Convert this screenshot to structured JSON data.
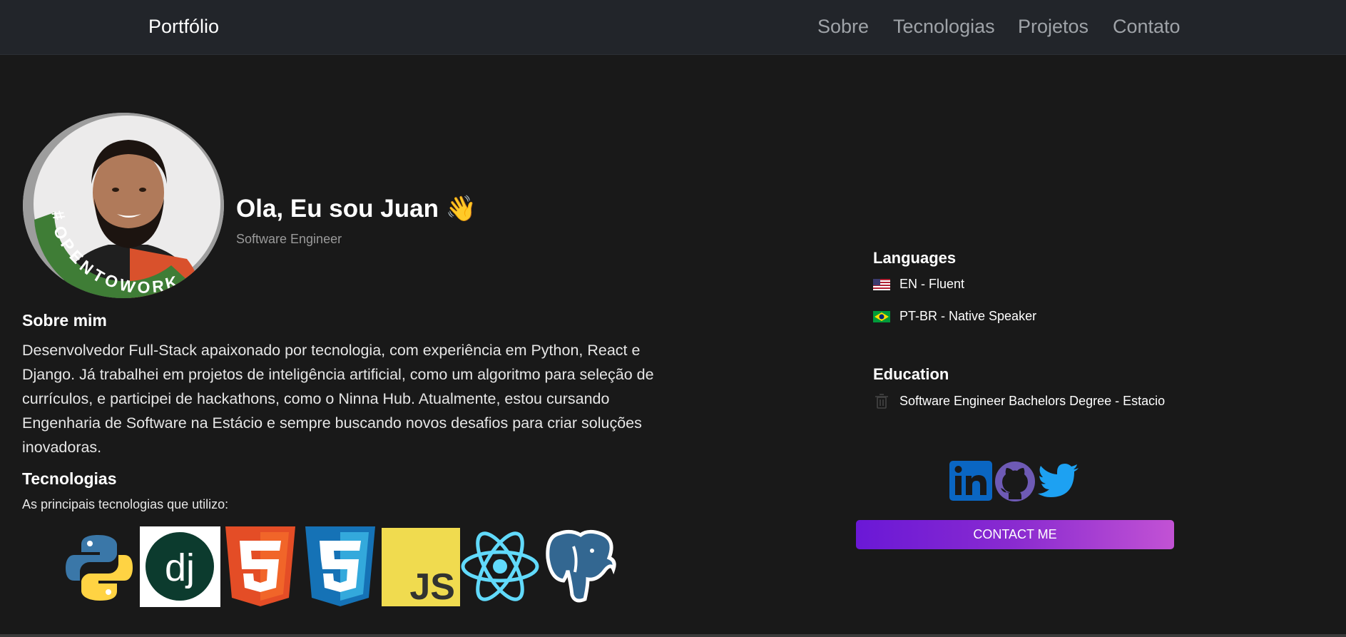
{
  "navbar": {
    "brand": "Portfólio",
    "links": [
      "Sobre",
      "Tecnologias",
      "Projetos",
      "Contato"
    ]
  },
  "hero": {
    "title": "Ola, Eu sou Juan 👋",
    "subtitle": "Software Engineer",
    "avatar_badge": "#OPENTOWORK"
  },
  "about": {
    "title": "Sobre mim",
    "text": "Desenvolvedor Full-Stack apaixonado por tecnologia, com experiência em Python, React e Django. Já trabalhei em projetos de inteligência artificial, como um algoritmo para seleção de currículos, e participei de hackathons, como o Ninna Hub. Atualmente, estou cursando Engenharia de Software na Estácio e sempre buscando novos desafios para criar soluções inovadoras."
  },
  "technologies": {
    "title": "Tecnologias",
    "subtitle": "As principais tecnologias que utilizo:",
    "icons": [
      "python-logo",
      "django-logo",
      "html5-logo",
      "css3-logo",
      "javascript-logo",
      "react-logo",
      "postgresql-logo"
    ]
  },
  "languages": {
    "title": "Languages",
    "items": [
      {
        "flag": "us-flag-icon",
        "label": "EN - Fluent"
      },
      {
        "flag": "br-flag-icon",
        "label": "PT-BR - Native Speaker"
      }
    ]
  },
  "education": {
    "title": "Education",
    "items": [
      {
        "icon": "trash-icon",
        "label": "Software Engineer Bachelors Degree - Estacio"
      }
    ]
  },
  "social": {
    "icons": [
      "linkedin-icon",
      "github-icon",
      "twitter-icon"
    ]
  },
  "contact_button": "CONTACT ME",
  "colors": {
    "background": "#191919",
    "navbar": "#22252a",
    "nav_link": "#9fa3a8",
    "button_gradient_start": "#6a18d6",
    "button_gradient_end": "#c252d4"
  }
}
